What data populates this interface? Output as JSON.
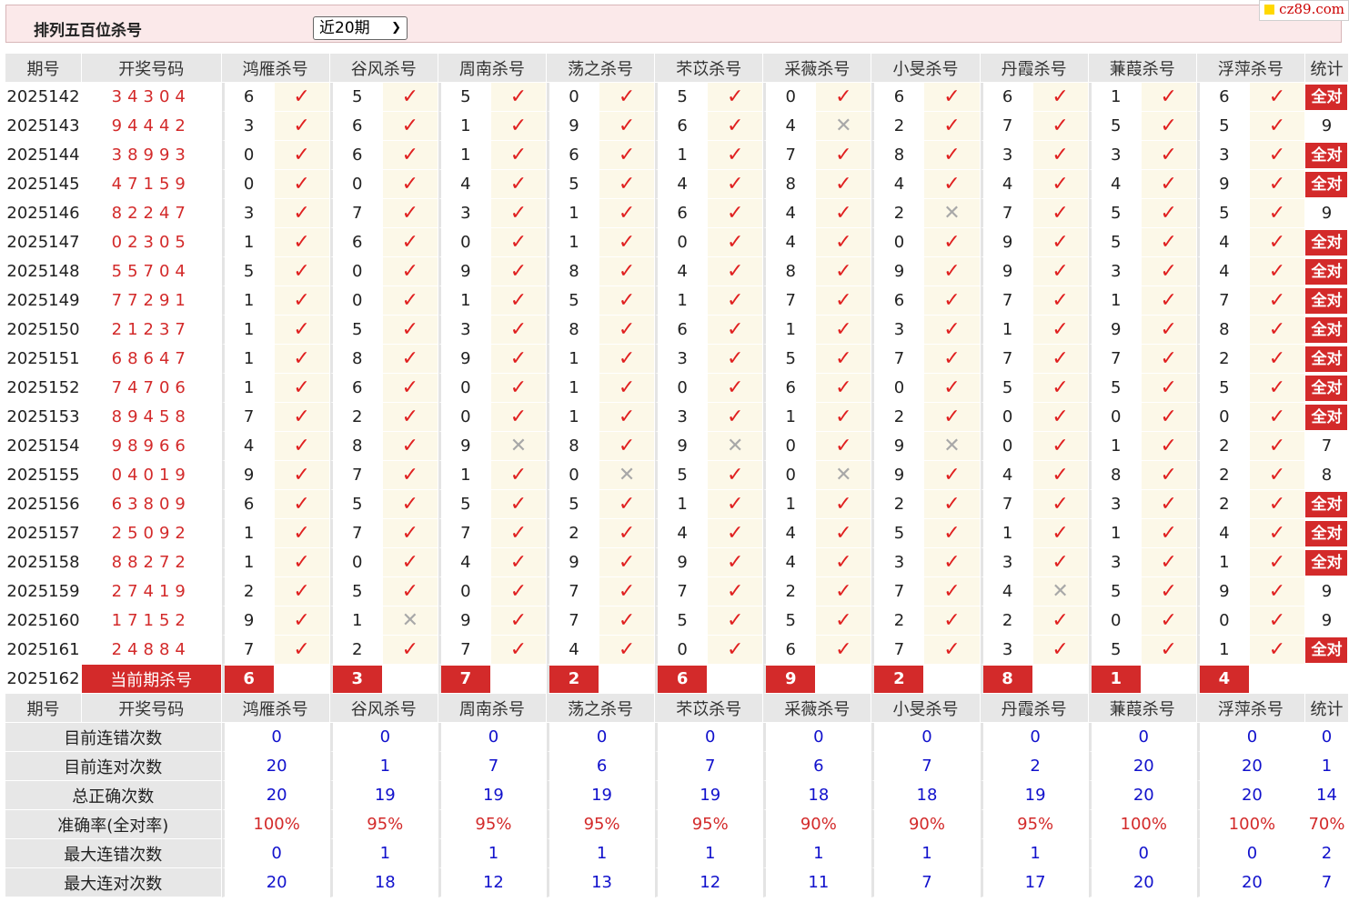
{
  "header": {
    "title": "排列五百位杀号",
    "period_select": "近20期",
    "logo": "cz89.com"
  },
  "columns": {
    "issue": "期号",
    "draw": "开奖号码",
    "stat": "统计",
    "experts": [
      "鸿雁杀号",
      "谷风杀号",
      "周南杀号",
      "荡之杀号",
      "芣苡杀号",
      "采薇杀号",
      "小旻杀号",
      "丹霞杀号",
      "蒹葭杀号",
      "浮萍杀号"
    ]
  },
  "all_correct_label": "全对",
  "rows": [
    {
      "issue": "2025142",
      "draw": "34304",
      "kills": [
        "6",
        "5",
        "5",
        "0",
        "5",
        "0",
        "6",
        "6",
        "1",
        "6"
      ],
      "hits": [
        1,
        1,
        1,
        1,
        1,
        1,
        1,
        1,
        1,
        1
      ],
      "stat": "全对"
    },
    {
      "issue": "2025143",
      "draw": "94442",
      "kills": [
        "3",
        "6",
        "1",
        "9",
        "6",
        "4",
        "2",
        "7",
        "5",
        "5"
      ],
      "hits": [
        1,
        1,
        1,
        1,
        1,
        0,
        1,
        1,
        1,
        1
      ],
      "stat": "9"
    },
    {
      "issue": "2025144",
      "draw": "38993",
      "kills": [
        "0",
        "6",
        "1",
        "6",
        "1",
        "7",
        "8",
        "3",
        "3",
        "3"
      ],
      "hits": [
        1,
        1,
        1,
        1,
        1,
        1,
        1,
        1,
        1,
        1
      ],
      "stat": "全对"
    },
    {
      "issue": "2025145",
      "draw": "47159",
      "kills": [
        "0",
        "0",
        "4",
        "5",
        "4",
        "8",
        "4",
        "4",
        "4",
        "9"
      ],
      "hits": [
        1,
        1,
        1,
        1,
        1,
        1,
        1,
        1,
        1,
        1
      ],
      "stat": "全对"
    },
    {
      "issue": "2025146",
      "draw": "82247",
      "kills": [
        "3",
        "7",
        "3",
        "1",
        "6",
        "4",
        "2",
        "7",
        "5",
        "5"
      ],
      "hits": [
        1,
        1,
        1,
        1,
        1,
        1,
        0,
        1,
        1,
        1
      ],
      "stat": "9"
    },
    {
      "issue": "2025147",
      "draw": "02305",
      "kills": [
        "1",
        "6",
        "0",
        "1",
        "0",
        "4",
        "0",
        "9",
        "5",
        "4"
      ],
      "hits": [
        1,
        1,
        1,
        1,
        1,
        1,
        1,
        1,
        1,
        1
      ],
      "stat": "全对"
    },
    {
      "issue": "2025148",
      "draw": "55704",
      "kills": [
        "5",
        "0",
        "9",
        "8",
        "4",
        "8",
        "9",
        "9",
        "3",
        "4"
      ],
      "hits": [
        1,
        1,
        1,
        1,
        1,
        1,
        1,
        1,
        1,
        1
      ],
      "stat": "全对"
    },
    {
      "issue": "2025149",
      "draw": "77291",
      "kills": [
        "1",
        "0",
        "1",
        "5",
        "1",
        "7",
        "6",
        "7",
        "1",
        "7"
      ],
      "hits": [
        1,
        1,
        1,
        1,
        1,
        1,
        1,
        1,
        1,
        1
      ],
      "stat": "全对"
    },
    {
      "issue": "2025150",
      "draw": "21237",
      "kills": [
        "1",
        "5",
        "3",
        "8",
        "6",
        "1",
        "3",
        "1",
        "9",
        "8"
      ],
      "hits": [
        1,
        1,
        1,
        1,
        1,
        1,
        1,
        1,
        1,
        1
      ],
      "stat": "全对"
    },
    {
      "issue": "2025151",
      "draw": "68647",
      "kills": [
        "1",
        "8",
        "9",
        "1",
        "3",
        "5",
        "7",
        "7",
        "7",
        "2"
      ],
      "hits": [
        1,
        1,
        1,
        1,
        1,
        1,
        1,
        1,
        1,
        1
      ],
      "stat": "全对"
    },
    {
      "issue": "2025152",
      "draw": "74706",
      "kills": [
        "1",
        "6",
        "0",
        "1",
        "0",
        "6",
        "0",
        "5",
        "5",
        "5"
      ],
      "hits": [
        1,
        1,
        1,
        1,
        1,
        1,
        1,
        1,
        1,
        1
      ],
      "stat": "全对"
    },
    {
      "issue": "2025153",
      "draw": "89458",
      "kills": [
        "7",
        "2",
        "0",
        "1",
        "3",
        "1",
        "2",
        "0",
        "0",
        "0"
      ],
      "hits": [
        1,
        1,
        1,
        1,
        1,
        1,
        1,
        1,
        1,
        1
      ],
      "stat": "全对"
    },
    {
      "issue": "2025154",
      "draw": "98966",
      "kills": [
        "4",
        "8",
        "9",
        "8",
        "9",
        "0",
        "9",
        "0",
        "1",
        "2"
      ],
      "hits": [
        1,
        1,
        0,
        1,
        0,
        1,
        0,
        1,
        1,
        1
      ],
      "stat": "7"
    },
    {
      "issue": "2025155",
      "draw": "04019",
      "kills": [
        "9",
        "7",
        "1",
        "0",
        "5",
        "0",
        "9",
        "4",
        "8",
        "2"
      ],
      "hits": [
        1,
        1,
        1,
        0,
        1,
        0,
        1,
        1,
        1,
        1
      ],
      "stat": "8"
    },
    {
      "issue": "2025156",
      "draw": "63809",
      "kills": [
        "6",
        "5",
        "5",
        "5",
        "1",
        "1",
        "2",
        "7",
        "3",
        "2"
      ],
      "hits": [
        1,
        1,
        1,
        1,
        1,
        1,
        1,
        1,
        1,
        1
      ],
      "stat": "全对"
    },
    {
      "issue": "2025157",
      "draw": "25092",
      "kills": [
        "1",
        "7",
        "7",
        "2",
        "4",
        "4",
        "5",
        "1",
        "1",
        "4"
      ],
      "hits": [
        1,
        1,
        1,
        1,
        1,
        1,
        1,
        1,
        1,
        1
      ],
      "stat": "全对"
    },
    {
      "issue": "2025158",
      "draw": "88272",
      "kills": [
        "1",
        "0",
        "4",
        "9",
        "9",
        "4",
        "3",
        "3",
        "3",
        "1"
      ],
      "hits": [
        1,
        1,
        1,
        1,
        1,
        1,
        1,
        1,
        1,
        1
      ],
      "stat": "全对"
    },
    {
      "issue": "2025159",
      "draw": "27419",
      "kills": [
        "2",
        "5",
        "0",
        "7",
        "7",
        "2",
        "7",
        "4",
        "5",
        "9"
      ],
      "hits": [
        1,
        1,
        1,
        1,
        1,
        1,
        1,
        0,
        1,
        1
      ],
      "stat": "9"
    },
    {
      "issue": "2025160",
      "draw": "17152",
      "kills": [
        "9",
        "1",
        "9",
        "7",
        "5",
        "5",
        "2",
        "2",
        "0",
        "0"
      ],
      "hits": [
        1,
        0,
        1,
        1,
        1,
        1,
        1,
        1,
        1,
        1
      ],
      "stat": "9"
    },
    {
      "issue": "2025161",
      "draw": "24884",
      "kills": [
        "7",
        "2",
        "7",
        "4",
        "0",
        "6",
        "7",
        "3",
        "5",
        "1"
      ],
      "hits": [
        1,
        1,
        1,
        1,
        1,
        1,
        1,
        1,
        1,
        1
      ],
      "stat": "全对"
    }
  ],
  "current": {
    "issue": "2025162",
    "label": "当前期杀号",
    "kills": [
      "6",
      "3",
      "7",
      "2",
      "6",
      "9",
      "2",
      "8",
      "1",
      "4"
    ]
  },
  "stats": [
    {
      "label": "目前连错次数",
      "values": [
        "0",
        "0",
        "0",
        "0",
        "0",
        "0",
        "0",
        "0",
        "0",
        "0"
      ],
      "total": "0",
      "red": false
    },
    {
      "label": "目前连对次数",
      "values": [
        "20",
        "1",
        "7",
        "6",
        "7",
        "6",
        "7",
        "2",
        "20",
        "20"
      ],
      "total": "1",
      "red": false
    },
    {
      "label": "总正确次数",
      "values": [
        "20",
        "19",
        "19",
        "19",
        "19",
        "18",
        "18",
        "19",
        "20",
        "20"
      ],
      "total": "14",
      "red": false
    },
    {
      "label": "准确率(全对率)",
      "values": [
        "100%",
        "95%",
        "95%",
        "95%",
        "95%",
        "90%",
        "90%",
        "95%",
        "100%",
        "100%"
      ],
      "total": "70%",
      "red": true
    },
    {
      "label": "最大连错次数",
      "values": [
        "0",
        "1",
        "1",
        "1",
        "1",
        "1",
        "1",
        "1",
        "0",
        "0"
      ],
      "total": "2",
      "red": false
    },
    {
      "label": "最大连对次数",
      "values": [
        "20",
        "18",
        "12",
        "13",
        "12",
        "11",
        "7",
        "17",
        "20",
        "20"
      ],
      "total": "7",
      "red": false
    }
  ]
}
